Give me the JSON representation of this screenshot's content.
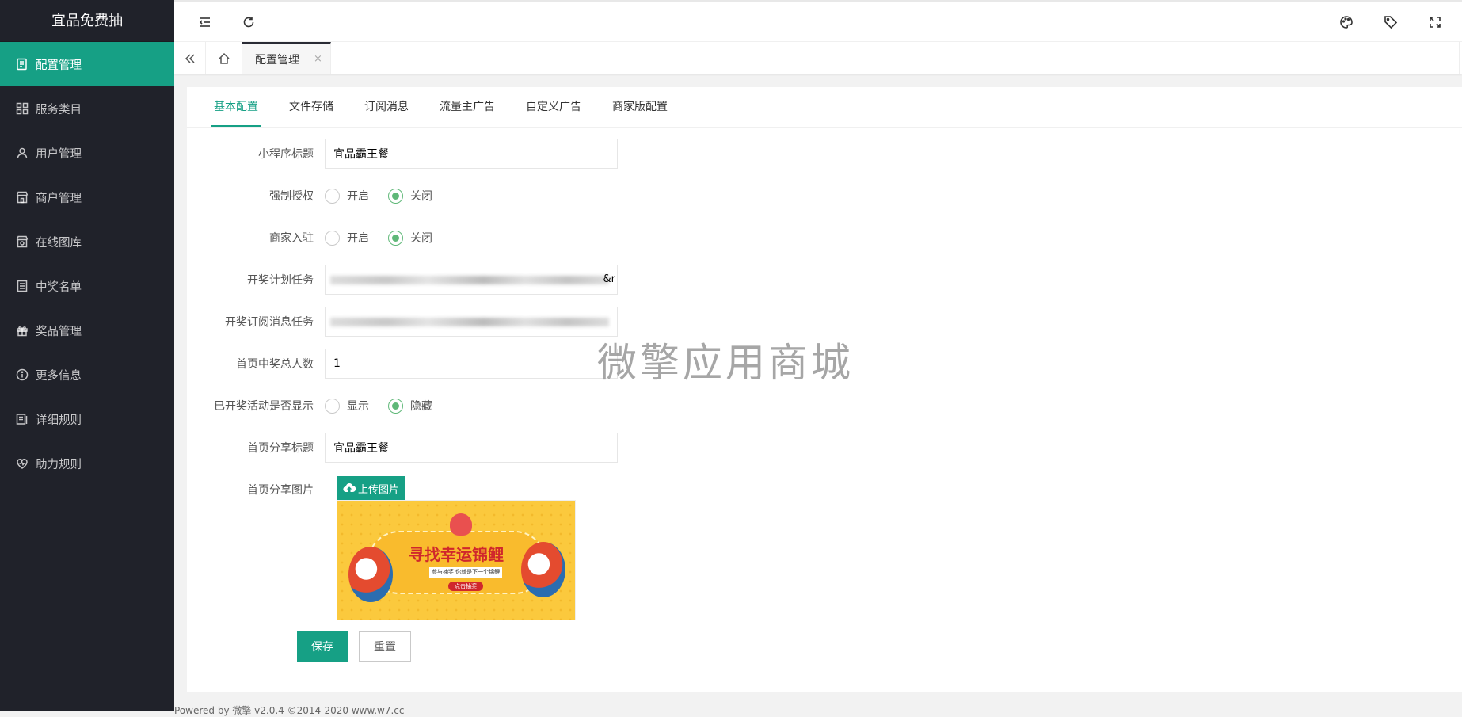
{
  "sidebar": {
    "brand": "宜品免费抽",
    "items": [
      {
        "label": "配置管理",
        "icon": "config-icon",
        "active": true
      },
      {
        "label": "服务类目",
        "icon": "grid-icon"
      },
      {
        "label": "用户管理",
        "icon": "user-icon"
      },
      {
        "label": "商户管理",
        "icon": "store-icon"
      },
      {
        "label": "在线图库",
        "icon": "gallery-icon"
      },
      {
        "label": "中奖名单",
        "icon": "list-icon"
      },
      {
        "label": "奖品管理",
        "icon": "gift-icon"
      },
      {
        "label": "更多信息",
        "icon": "info-icon"
      },
      {
        "label": "详细规则",
        "icon": "rules-icon"
      },
      {
        "label": "助力规则",
        "icon": "heart-icon"
      }
    ]
  },
  "tabs": {
    "current": "配置管理",
    "close": "×"
  },
  "subtabs": [
    "基本配置",
    "文件存储",
    "订阅消息",
    "流量主广告",
    "自定义广告",
    "商家版配置"
  ],
  "form": {
    "mini_title_label": "小程序标题",
    "mini_title_value": "宜品霸王餐",
    "force_auth_label": "强制授权",
    "merchant_join_label": "商家入驻",
    "radio_on": "开启",
    "radio_off": "关闭",
    "lottery_task_label": "开奖计划任务",
    "lottery_task_tail": "&r",
    "subscribe_task_label": "开奖订阅消息任务",
    "home_winners_label": "首页中奖总人数",
    "home_winners_value": "1",
    "show_finished_label": "已开奖活动是否显示",
    "radio_show": "显示",
    "radio_hide": "隐藏",
    "share_title_label": "首页分享标题",
    "share_title_value": "宜品霸王餐",
    "share_image_label": "首页分享图片",
    "upload_label": "上传图片",
    "save_label": "保存",
    "reset_label": "重置"
  },
  "preview": {
    "title": "寻找幸运锦鲤",
    "sub": "参与抽奖 你就是下一个锦鲤",
    "btn": "点击抽奖"
  },
  "watermark": "微擎应用商城",
  "footer": "Powered by 微擎 v2.0.4 ©2014-2020 www.w7.cc",
  "colors": {
    "accent": "#16a085",
    "sidebar": "#20222a",
    "radio": "#5fb878"
  }
}
